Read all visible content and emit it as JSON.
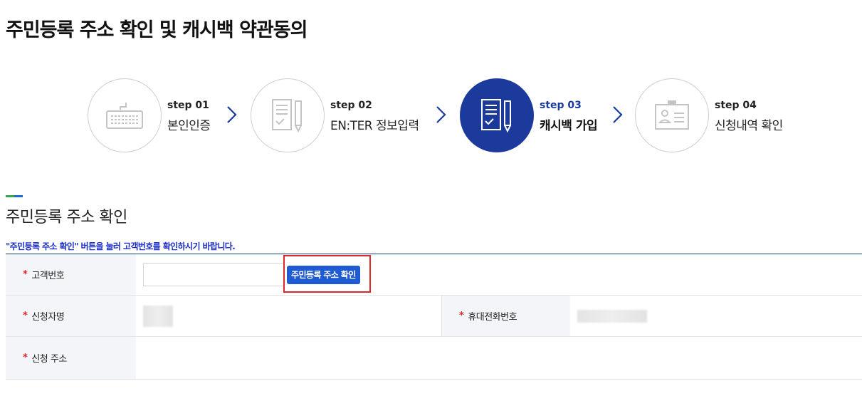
{
  "page": {
    "title": "주민등록 주소 확인 및 캐시백 약관동의"
  },
  "steps": [
    {
      "num": "step 01",
      "label": "본인인증",
      "icon": "keyboard-icon",
      "active": false
    },
    {
      "num": "step 02",
      "label": "EN:TER 정보입력",
      "icon": "document-pencil-icon",
      "active": false
    },
    {
      "num": "step 03",
      "label": "캐시백 가입",
      "icon": "document-pencil-icon",
      "active": true
    },
    {
      "num": "step 04",
      "label": "신청내역 확인",
      "icon": "id-card-icon",
      "active": false
    }
  ],
  "section": {
    "title": "주민등록 주소 확인",
    "notice": "\"주민등록 주소 확인\" 버튼을 눌러 고객번호를 확인하시기 바랍니다."
  },
  "form": {
    "required_mark": "*",
    "customer_no_label": "고객번호",
    "customer_no_value": "",
    "lookup_button": "주민등록 주소 확인",
    "applicant_label": "신청자명",
    "phone_label": "휴대전화번호",
    "address_label": "신청 주소"
  },
  "colors": {
    "accent": "#1b3a9c",
    "button": "#1f5bd3",
    "required": "#e0262d",
    "notice": "#1c2fc7",
    "highlight_frame": "#e0262d"
  }
}
